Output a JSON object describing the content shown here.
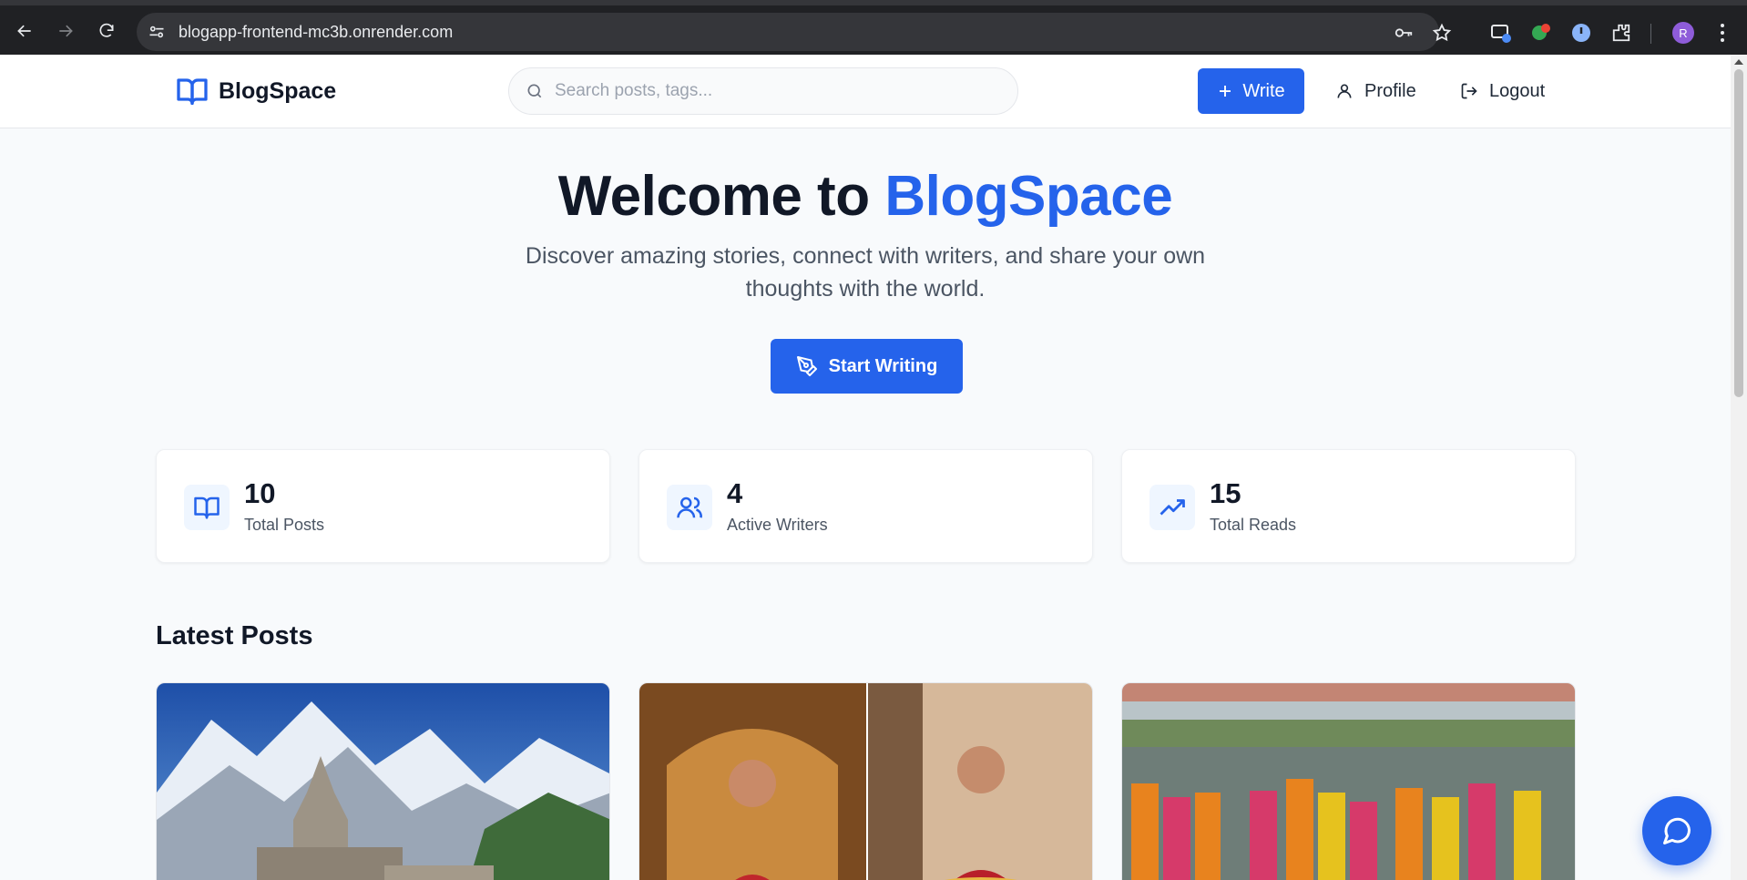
{
  "browser": {
    "url": "blogapp-frontend-mc3b.onrender.com",
    "profile_initial": "R",
    "icons": [
      "back-icon",
      "forward-icon",
      "reload-icon",
      "site-settings-icon",
      "password-key-icon",
      "bookmark-star-icon",
      "extension-icon",
      "menu-kebab-icon"
    ]
  },
  "header": {
    "brand": "BlogSpace",
    "search_placeholder": "Search posts, tags...",
    "write_label": "Write",
    "profile_label": "Profile",
    "logout_label": "Logout"
  },
  "hero": {
    "title_prefix": "Welcome to ",
    "title_accent": "BlogSpace",
    "subtitle": "Discover amazing stories, connect with writers, and share your own thoughts with the world.",
    "cta_label": "Start Writing"
  },
  "stats": [
    {
      "value": "10",
      "label": "Total Posts",
      "icon": "book-open-icon"
    },
    {
      "value": "4",
      "label": "Active Writers",
      "icon": "users-icon"
    },
    {
      "value": "15",
      "label": "Total Reads",
      "icon": "trending-up-icon"
    }
  ],
  "latest": {
    "title": "Latest Posts"
  },
  "colors": {
    "accent": "#2563eb",
    "background": "#f8fafc",
    "text": "#111827"
  }
}
